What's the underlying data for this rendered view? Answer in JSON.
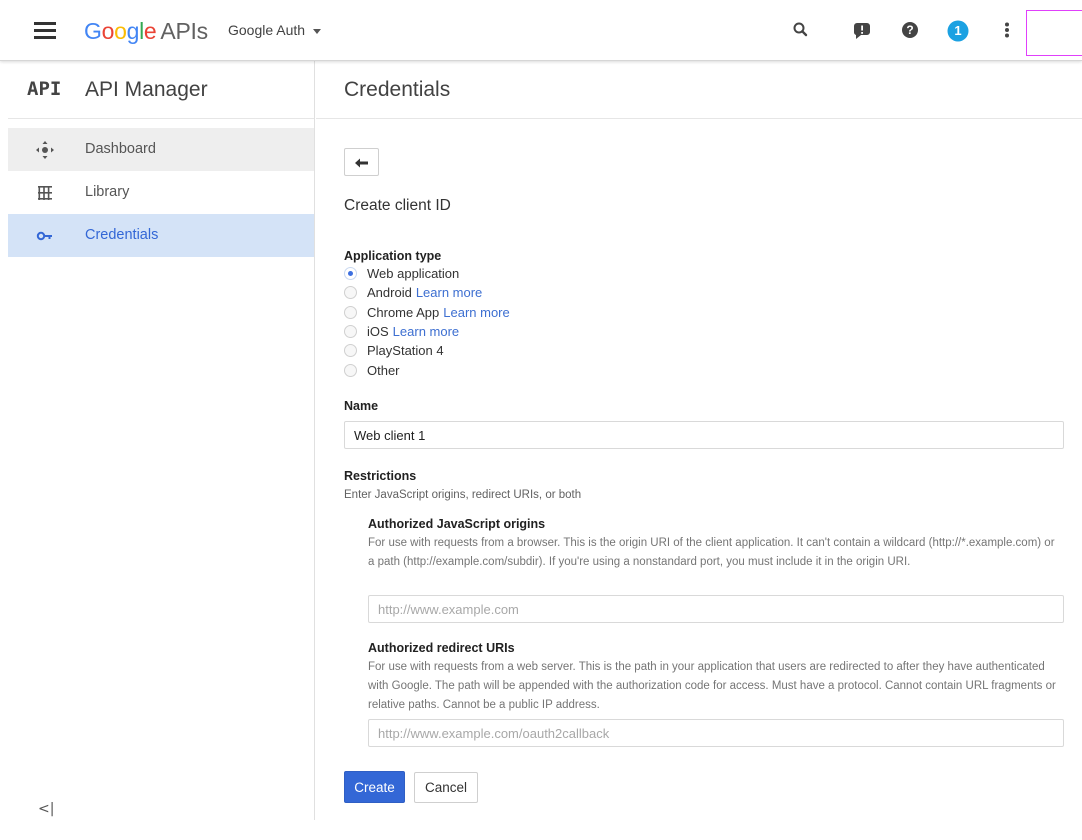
{
  "header": {
    "logo": {
      "g": "G",
      "o1": "o",
      "o2": "o",
      "g2": "g",
      "l": "l",
      "e": "e",
      "apis": "APIs"
    },
    "project": "Google Auth",
    "notification_count": "1",
    "colors": {
      "blue": "#4285f4",
      "red": "#ea4335",
      "yellow": "#fbbc05",
      "green": "#34a853",
      "notif": "#1ba1e2"
    }
  },
  "sidebar": {
    "mark": "API",
    "title": "API Manager",
    "items": [
      {
        "label": "Dashboard",
        "icon": "dashboard-icon"
      },
      {
        "label": "Library",
        "icon": "library-icon"
      },
      {
        "label": "Credentials",
        "icon": "key-icon",
        "active": true
      }
    ],
    "collapse": "<|"
  },
  "main": {
    "title": "Credentials",
    "section_title": "Create client ID",
    "app_type_label": "Application type",
    "app_types": [
      {
        "label": "Web application",
        "checked": true
      },
      {
        "label": "Android",
        "link": "Learn more"
      },
      {
        "label": "Chrome App",
        "link": "Learn more"
      },
      {
        "label": "iOS",
        "link": "Learn more"
      },
      {
        "label": "PlayStation 4"
      },
      {
        "label": "Other"
      }
    ],
    "name_label": "Name",
    "name_value": "Web client 1",
    "restrictions_label": "Restrictions",
    "restrictions_desc": "Enter JavaScript origins, redirect URIs, or both",
    "js_origins": {
      "title": "Authorized JavaScript origins",
      "desc": "For use with requests from a browser. This is the origin URI of the client application. It can't contain a wildcard (http://*.example.com) or a path (http://example.com/subdir). If you're using a nonstandard port, you must include it in the origin URI.",
      "placeholder": "http://www.example.com"
    },
    "redirect_uris": {
      "title": "Authorized redirect URIs",
      "desc": "For use with requests from a web server. This is the path in your application that users are redirected to after they have authenticated with Google. The path will be appended with the authorization code for access. Must have a protocol. Cannot contain URL fragments or relative paths. Cannot be a public IP address.",
      "placeholder": "http://www.example.com/oauth2callback"
    },
    "create_label": "Create",
    "cancel_label": "Cancel"
  }
}
